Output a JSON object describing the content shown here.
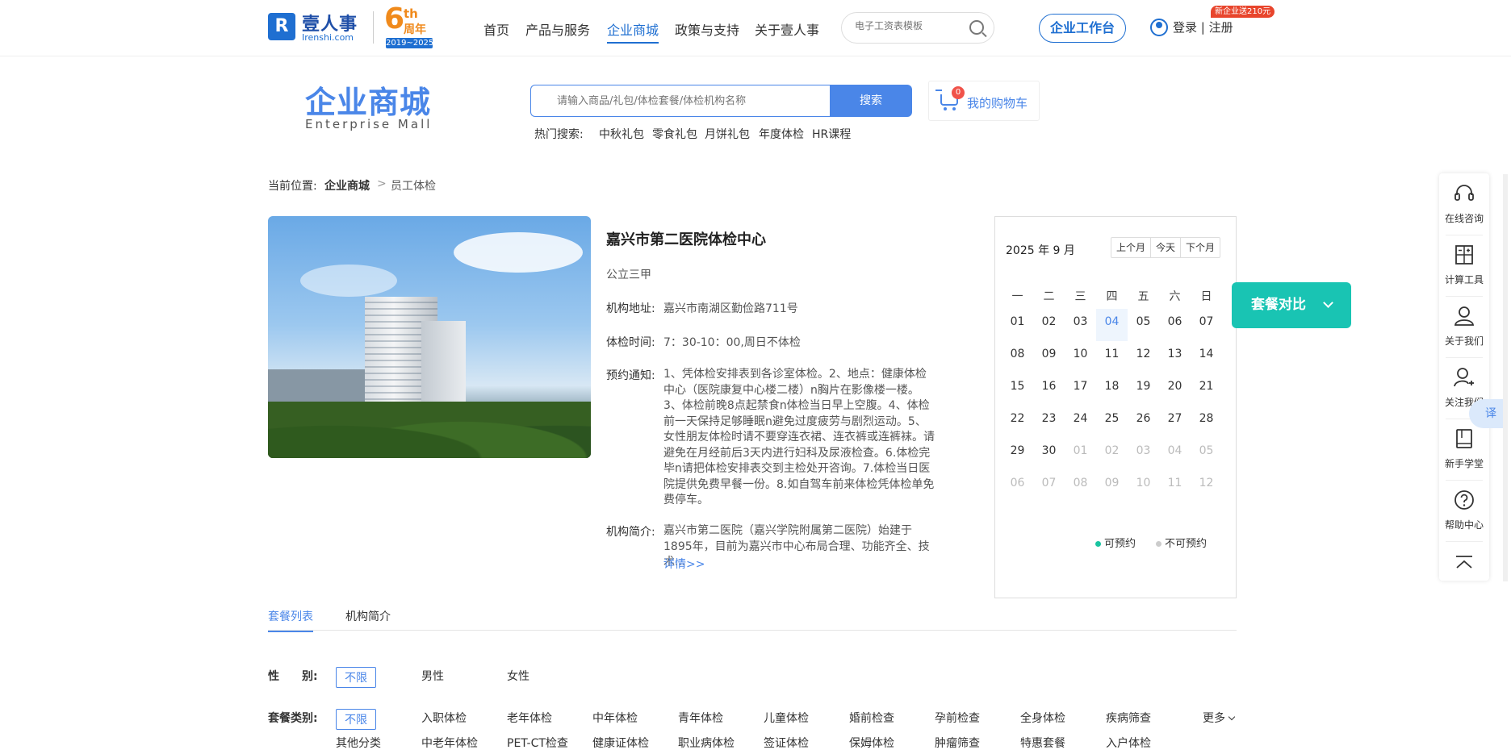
{
  "topnav": {
    "logo_cn": "壹人事",
    "logo_en": "Irenshi.com",
    "anniversary_num": "6",
    "anniversary_sup": "th",
    "anniversary_zh": "周年",
    "anniversary_years": "2019~2025",
    "items": [
      {
        "label": "首页"
      },
      {
        "label": "产品与服务"
      },
      {
        "label": "企业商城"
      },
      {
        "label": "政策与支持"
      },
      {
        "label": "关于壹人事"
      }
    ],
    "search_placeholder": "电子工资表模板",
    "workbench_label": "企业工作台",
    "login_label": "登录 | 注册",
    "promo_badge": "新企业送210元"
  },
  "mall": {
    "title_cn": "企业商城",
    "title_en": "Enterprise  Mall",
    "search_placeholder": "请输入商品/礼包/体检套餐/体检机构名称",
    "search_button": "搜索",
    "hot_label": "热门搜索:",
    "hot_items": [
      "中秋礼包",
      "零食礼包",
      "月饼礼包",
      "年度体检",
      "HR课程"
    ],
    "cart_label": "我的购物车",
    "cart_count": "0"
  },
  "breadcrumb": {
    "prefix": "当前位置:",
    "level1": "企业商城",
    "separator": ">",
    "level2": "员工体检"
  },
  "institution": {
    "name": "嘉兴市第二医院体检中心",
    "level": "公立三甲",
    "address_label": "机构地址:",
    "address": "嘉兴市南湖区勤俭路711号",
    "hours_label": "体检时间:",
    "hours": "7：30-10：00,周日不体检",
    "notice_label": "预约通知:",
    "notice": "1、凭体检安排表到各诊室体检。2、地点：健康体检中心（医院康复中心楼二楼）n胸片在影像楼一楼。3、体检前晚8点起禁食n体检当日早上空腹。4、体检前一天保持足够睡眠n避免过度疲劳与剧烈运动。5、女性朋友体检时请不要穿连衣裙、连衣裤或连裤袜。请避免在月经前后3天内进行妇科及尿液检查。6.体检完毕n请把体检安排表交到主检处开咨询。7.体检当日医院提供免费早餐一份。8.如自驾车前来体检凭体检单免费停车。",
    "intro_label": "机构简介:",
    "intro": "嘉兴市第二医院（嘉兴学院附属第二医院）始建于1895年，目前为嘉兴市中心布局合理、功能齐全、技术...",
    "more_link": "详情>>"
  },
  "calendar": {
    "title": "2025 年 9 月",
    "prev_label": "上个月",
    "today_label": "今天",
    "next_label": "下个月",
    "weekdays": [
      "一",
      "二",
      "三",
      "四",
      "五",
      "六",
      "日"
    ],
    "weeks": [
      [
        "01",
        "02",
        "03",
        "04",
        "05",
        "06",
        "07"
      ],
      [
        "08",
        "09",
        "10",
        "11",
        "12",
        "13",
        "14"
      ],
      [
        "15",
        "16",
        "17",
        "18",
        "19",
        "20",
        "21"
      ],
      [
        "22",
        "23",
        "24",
        "25",
        "26",
        "27",
        "28"
      ],
      [
        "29",
        "30",
        "01",
        "02",
        "03",
        "04",
        "05"
      ],
      [
        "06",
        "07",
        "08",
        "09",
        "10",
        "11",
        "12"
      ]
    ],
    "legend_available": "可预约",
    "legend_unavailable": "不可预约",
    "available_color": "#19c4a0",
    "unavailable_color": "#cccccc"
  },
  "compare_button": "套餐对比",
  "sidebar": {
    "items": [
      {
        "label": "在线咨询",
        "icon": "headset-icon"
      },
      {
        "label": "计算工具",
        "icon": "calculator-icon"
      },
      {
        "label": "关于我们",
        "icon": "person-icon"
      },
      {
        "label": "关注我们",
        "icon": "add-person-icon"
      },
      {
        "label": "新手学堂",
        "icon": "book-icon"
      },
      {
        "label": "帮助中心",
        "icon": "help-icon"
      }
    ],
    "translate_label": "译"
  },
  "tabs": [
    {
      "label": "套餐列表"
    },
    {
      "label": "机构简介"
    }
  ],
  "filters": {
    "gender_label": "性　　别:",
    "gender_options": [
      "不限",
      "男性",
      "女性"
    ],
    "category_label": "套餐类别:",
    "category_row1": [
      "不限",
      "入职体检",
      "老年体检",
      "中年体检",
      "青年体检",
      "儿童体检",
      "婚前检查",
      "孕前检查",
      "全身体检",
      "疾病筛查"
    ],
    "category_row2": [
      "其他分类",
      "中老年体检",
      "PET-CT检查",
      "健康证体检",
      "职业病体检",
      "签证体检",
      "保姆体检",
      "肿瘤筛查",
      "特惠套餐",
      "入户体检"
    ],
    "more_label": "更多"
  },
  "colors": {
    "accent": "#4a86e8",
    "brand": "#1f6fd1",
    "compare": "#19c4b3"
  }
}
